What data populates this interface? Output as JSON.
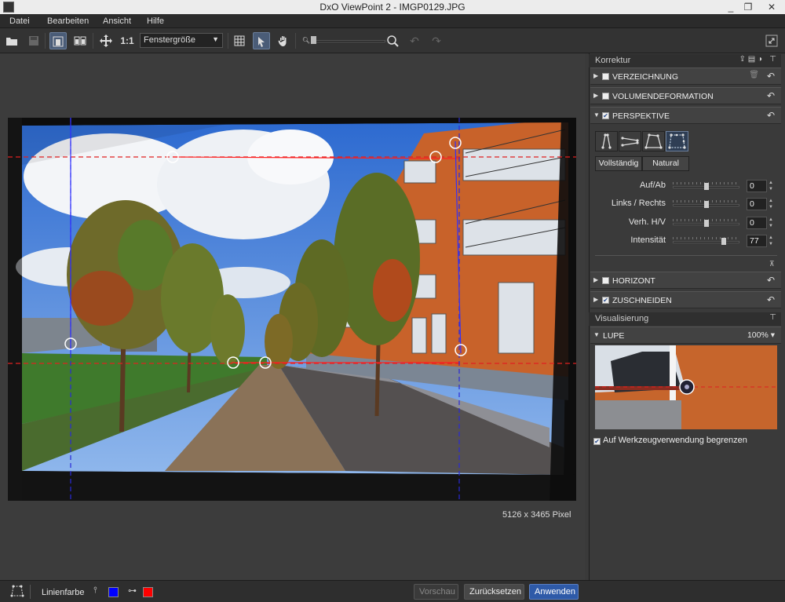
{
  "window": {
    "title": "DxO ViewPoint 2 - IMGP0129.JPG",
    "minimize": "_",
    "maximize": "❐",
    "close": "✕"
  },
  "menu": {
    "items": [
      "Datei",
      "Bearbeiten",
      "Ansicht",
      "Hilfe"
    ]
  },
  "toolbar": {
    "zoom_1to1": "1:1",
    "fit_mode": "Fenstergröße"
  },
  "canvas": {
    "pixel_info": "5126 x 3465 Pixel"
  },
  "status": {
    "line_color_label": "Linienfarbe",
    "vertical_line_color": "#0000ff",
    "horizontal_line_color": "#ff0000",
    "preview_label": "Vorschau",
    "reset_label": "Zurücksetzen",
    "apply_label": "Anwenden"
  },
  "panel": {
    "correction_title": "Korrektur",
    "sections": {
      "distortion": {
        "label": "VERZEICHNUNG",
        "checked": false
      },
      "volume": {
        "label": "VOLUMENDEFORMATION",
        "checked": false
      },
      "perspective": {
        "label": "PERSPEKTIVE",
        "checked": true
      },
      "horizon": {
        "label": "HORIZONT",
        "checked": false
      },
      "crop": {
        "label": "ZUSCHNEIDEN",
        "checked": true
      }
    },
    "perspective": {
      "modes": [
        "Vollständig",
        "Natural"
      ],
      "sliders": [
        {
          "label": "Auf/Ab",
          "value": "0",
          "pos": 0.5
        },
        {
          "label": "Links / Rechts",
          "value": "0",
          "pos": 0.5
        },
        {
          "label": "Verh. H/V",
          "value": "0",
          "pos": 0.5
        },
        {
          "label": "Intensität",
          "value": "77",
          "pos": 0.77
        }
      ]
    },
    "visualization_title": "Visualisierung",
    "loupe": {
      "label": "LUPE",
      "zoom": "100%"
    },
    "limit_label": "Auf Werkzeugverwendung begrenzen"
  },
  "colors": {
    "accent": "#4a6fa5",
    "panel_bg": "#3a3a3a",
    "apply_bg": "#2e5aa8",
    "building": "#c8622a"
  }
}
